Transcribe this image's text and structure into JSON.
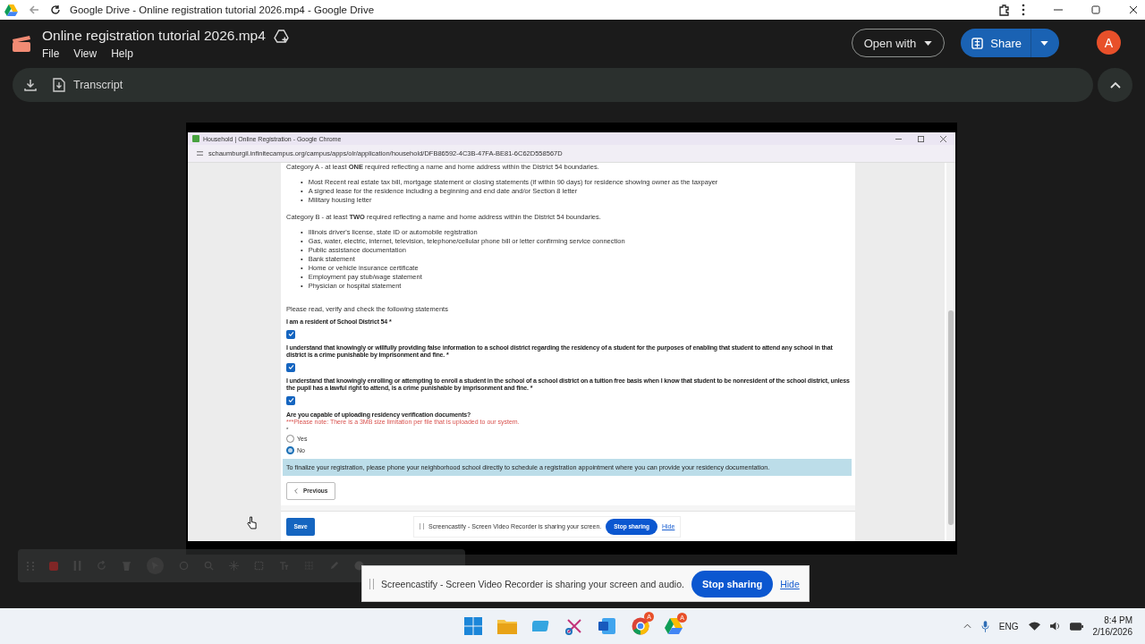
{
  "browser": {
    "title": "Google Drive - Online registration tutorial 2026.mp4 - Google Drive"
  },
  "drive": {
    "file_title": "Online registration tutorial 2026.mp4",
    "menu": [
      "File",
      "View",
      "Help"
    ],
    "open_with": "Open with",
    "share": "Share",
    "avatar": "A",
    "transcript": "Transcript"
  },
  "video": {
    "window_title": "Household | Online Registration - Google Chrome",
    "url": "schaumburgil.infinitecampus.org/campus/apps/olr/application/household/DFB86592-4C3B-47FA-BE81-6C62D558567D",
    "category_a": "Category A - at least **ONE** required reflecting a name and home address within the District 54 boundaries.",
    "category_a_items": [
      "Most Recent real estate tax bill, mortgage statement or closing statements (if within 90 days) for residence showing owner as the taxpayer",
      "A signed lease for the residence including a beginning and end date and/or Section 8 letter",
      "Military housing letter"
    ],
    "category_b": "Category B - at least **TWO** required reflecting a name and home address within the District 54 boundaries.",
    "category_b_items": [
      "Illinois driver's license, state ID or automobile registration",
      "Gas, water, electric, internet, television, telephone/cellular phone bill or letter confirming service connection",
      "Public assistance documentation",
      "Bank statement",
      "Home or vehicle insurance certificate",
      "Employment pay stub/wage statement",
      "Physician or hospital statement"
    ],
    "instruction": "Please read, verify and check the following statements",
    "statements": [
      {
        "text": "I am a resident of School District 54 *",
        "checked": true
      },
      {
        "text": "I understand that knowingly or willfully providing false information to a school district regarding the residency of a student for the purposes of enabling that student to attend any school in that district is a crime punishable by imprisonment and fine. *",
        "checked": true
      },
      {
        "text": "I understand that knowingly enrolling or attempting to enroll a student in the school of a school district on a tuition free basis when I know that student to be nonresident of the school district, unless the pupil has a lawful right to attend, is a crime punishable by imprisonment and fine. *",
        "checked": true
      }
    ],
    "question": "Are you capable of uploading residency verification documents?",
    "note": "***Please note:  There is a 3MB size limitation per file that is uploaded to our system.",
    "required": "*",
    "options": [
      {
        "label": "Yes",
        "selected": false
      },
      {
        "label": "No",
        "selected": true
      }
    ],
    "info": "To finalize your registration, please phone your neighborhood school directly to schedule a registration appointment where you can provide your residency documentation.",
    "bullet": "•",
    "previous": "Previous",
    "save": "Save",
    "share_bar": {
      "text": "Screencastify - Screen Video Recorder is sharing your screen.",
      "stop": "Stop sharing",
      "hide": "Hide"
    }
  },
  "share_bar": {
    "text": "Screencastify - Screen Video Recorder is sharing your screen and audio.",
    "stop": "Stop sharing",
    "hide": "Hide"
  },
  "taskbar": {
    "chrome_badge": "A",
    "drive_badge": "A",
    "language": "ENG",
    "time": "8:4 PM",
    "date": "2/16/2026"
  }
}
